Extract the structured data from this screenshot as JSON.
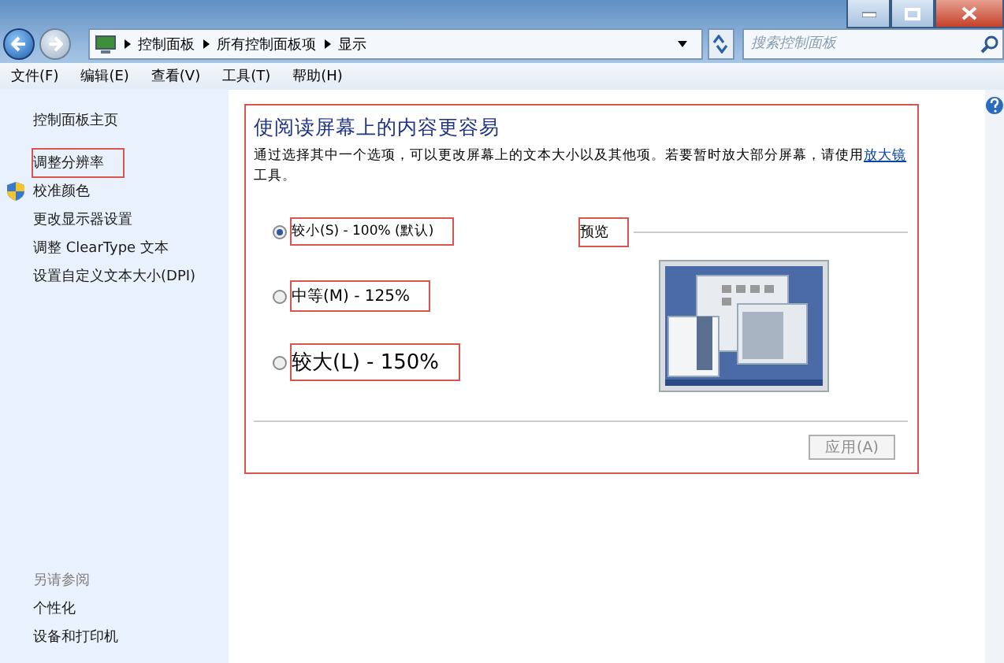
{
  "breadcrumb": [
    "控制面板",
    "所有控制面板项",
    "显示"
  ],
  "search": {
    "placeholder": "搜索控制面板"
  },
  "menu": [
    "文件(F)",
    "编辑(E)",
    "查看(V)",
    "工具(T)",
    "帮助(H)"
  ],
  "sidebar": {
    "items": [
      {
        "label": "控制面板主页",
        "kind": "link",
        "highlighted": false
      },
      {
        "label": "调整分辨率",
        "kind": "link",
        "highlighted": true
      },
      {
        "label": "校准颜色",
        "kind": "shield",
        "highlighted": false
      },
      {
        "label": "更改显示器设置",
        "kind": "link",
        "highlighted": false
      },
      {
        "label": "调整 ClearType 文本",
        "kind": "link",
        "highlighted": false
      },
      {
        "label": "设置自定义文本大小(DPI)",
        "kind": "link",
        "highlighted": false
      }
    ],
    "see_also": {
      "title": "另请参阅",
      "items": [
        "个性化",
        "设备和打印机"
      ]
    }
  },
  "panel": {
    "highlighted": true,
    "title": "使阅读屏幕上的内容更容易",
    "description": "通过选择其中一个选项，可以更改屏幕上的文本大小以及其他项。若要暂时放大部分屏幕，请使用",
    "link": "放大镜",
    "description_end": "工具。",
    "options": [
      {
        "label": "较小(S) - 100% (默认)",
        "kind": "small",
        "selected": true
      },
      {
        "label": "中等(M) - 125%",
        "kind": "medium",
        "selected": false
      },
      {
        "label": "较大(L) - 150%",
        "kind": "large",
        "selected": false
      }
    ],
    "preview_label": "预览",
    "apply_button": {
      "label": "应用(A)",
      "disabled": true
    }
  }
}
